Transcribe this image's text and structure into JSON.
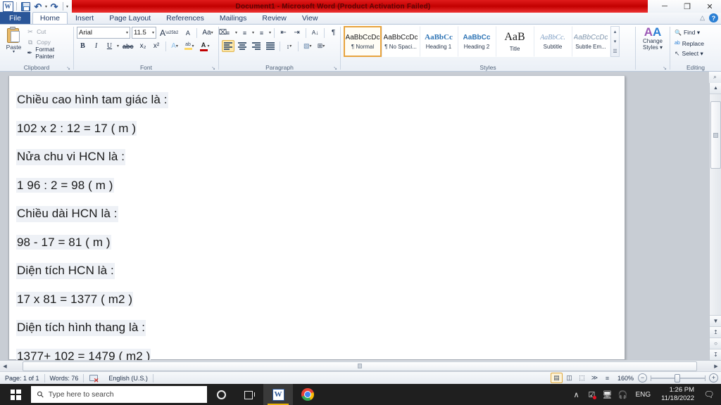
{
  "window": {
    "title": "Document1  -  Microsoft Word (Product Activation Failed)",
    "minimize": "─",
    "restore": "❐",
    "close": "✕",
    "collapse_ribbon": "△",
    "help": "?"
  },
  "quick_access": {
    "app_icon": "W",
    "save": "save-icon",
    "undo": "↶",
    "redo": "↷",
    "caret": "▾"
  },
  "tabs": [
    {
      "label": "File",
      "active": false,
      "file": true
    },
    {
      "label": "Home",
      "active": true,
      "file": false
    },
    {
      "label": "Insert",
      "active": false,
      "file": false
    },
    {
      "label": "Page Layout",
      "active": false,
      "file": false
    },
    {
      "label": "References",
      "active": false,
      "file": false
    },
    {
      "label": "Mailings",
      "active": false,
      "file": false
    },
    {
      "label": "Review",
      "active": false,
      "file": false
    },
    {
      "label": "View",
      "active": false,
      "file": false
    }
  ],
  "ribbon": {
    "clipboard": {
      "label": "Clipboard",
      "paste": "Paste",
      "paste_caret": "▾",
      "items": [
        {
          "label": "Cut",
          "glyph": "✂",
          "enabled": false
        },
        {
          "label": "Copy",
          "glyph": "⧉",
          "enabled": false
        },
        {
          "label": "Format Painter",
          "glyph": "✒",
          "enabled": true
        }
      ]
    },
    "font": {
      "label": "Font",
      "font_name": "Arial",
      "font_size": "11.5",
      "caret": "▾",
      "grow_font": "A",
      "shrink_font": "A",
      "change_case": "Aa",
      "clear_formatting": "⌧",
      "bold": "B",
      "italic": "I",
      "underline": "U",
      "strikethrough": "abc",
      "subscript": "x₂",
      "superscript": "x²",
      "text_effects": "A",
      "highlight": "ab",
      "font_color": "A"
    },
    "paragraph": {
      "label": "Paragraph",
      "bullets": "≡",
      "numbering": "≡",
      "multilevel": "≡",
      "decrease_indent": "⇤",
      "increase_indent": "⇥",
      "sort": "A↓",
      "show_marks": "¶",
      "align_left": "align-left",
      "align_center": "align-center",
      "align_right": "align-right",
      "justify": "justify",
      "line_spacing": "↕",
      "shading": "▧",
      "borders": "⊞"
    },
    "styles": {
      "label": "Styles",
      "items": [
        {
          "preview": "AaBbCcDc",
          "name": "¶ Normal",
          "selected": true,
          "cls": ""
        },
        {
          "preview": "AaBbCcDc",
          "name": "¶ No Spaci...",
          "selected": false,
          "cls": ""
        },
        {
          "preview": "AaBbCс",
          "name": "Heading 1",
          "selected": false,
          "cls": "h1"
        },
        {
          "preview": "AaBbCc",
          "name": "Heading 2",
          "selected": false,
          "cls": "h2"
        },
        {
          "preview": "AaB",
          "name": "Title",
          "selected": false,
          "cls": "title"
        },
        {
          "preview": "AaBbCc.",
          "name": "Subtitle",
          "selected": false,
          "cls": "subtle"
        },
        {
          "preview": "AaBbCcDc",
          "name": "Subtle Em...",
          "selected": false,
          "cls": "subem"
        }
      ],
      "scroll_up": "▴",
      "scroll_down": "▾",
      "more": "☰"
    },
    "change_styles": {
      "label_line1": "Change",
      "label_line2": "Styles ▾",
      "icon": "AA"
    },
    "editing": {
      "label": "Editing",
      "items": [
        {
          "label": "Find ▾",
          "glyph": "🔍"
        },
        {
          "label": "Replace",
          "glyph": "ab"
        },
        {
          "label": "Select ▾",
          "glyph": "↖"
        }
      ]
    },
    "dialog_launcher": "↘"
  },
  "document": {
    "lines": [
      {
        "text": "Chiều cao hình tam giác  là :",
        "spell": "mixed"
      },
      {
        "text": "102 x 2 : 12 = 17 ( m )",
        "spell": "green"
      },
      {
        "text": "Nửa chu vi HCN là :",
        "spell": "mixed"
      },
      {
        "text": "1 96 : 2 = 98 ( m )",
        "spell": "green"
      },
      {
        "text": "Chiều dài HCN là :",
        "spell": "mixed"
      },
      {
        "text": "98 - 17 = 81 ( m )",
        "spell": "green"
      },
      {
        "text": "Diện tích HCN là :",
        "spell": "mixed"
      },
      {
        "text": "17 x 81 = 1377 ( m2 )",
        "spell": "green"
      },
      {
        "text": " Diện tích hình thang là :",
        "spell": "mixed"
      },
      {
        "text": "1377+ 102 = 1479 ( m2 )",
        "spell": "green"
      }
    ]
  },
  "status_bar": {
    "page": "Page: 1 of 1",
    "words": "Words: 76",
    "proofing": "proofing-errors-icon",
    "language": "English (U.S.)",
    "zoom_level": "160%",
    "zoom_out": "−",
    "zoom_in": "+",
    "views": [
      {
        "name": "print-layout",
        "glyph": "▤",
        "selected": true
      },
      {
        "name": "full-screen-reading",
        "glyph": "◫",
        "selected": false
      },
      {
        "name": "web-layout",
        "glyph": "⬚",
        "selected": false
      },
      {
        "name": "outline",
        "glyph": "≫",
        "selected": false
      },
      {
        "name": "draft",
        "glyph": "≡",
        "selected": false
      }
    ]
  },
  "scrollbars": {
    "v_up": "▲",
    "v_down": "▼",
    "v_prev_page": "↥",
    "v_select_object": "○",
    "v_next_page": "↧",
    "ruler_toggle": "⌕",
    "h_left": "◀",
    "h_right": "▶"
  },
  "taskbar": {
    "start": "start-button",
    "search_placeholder": "Type here to search",
    "cortana": "cortana-icon",
    "task_view": "task-view-icon",
    "apps": [
      {
        "name": "word",
        "label": "W",
        "active": true
      },
      {
        "name": "chrome",
        "label": "",
        "active": false
      }
    ],
    "tray": {
      "show_hidden": "∧",
      "security": "🛡",
      "network": "🖧",
      "volume": "🔊",
      "language": "ENG",
      "time": "1:26 PM",
      "date": "11/18/2022",
      "action_center": "🗪"
    }
  },
  "colors": {
    "title_red": "#c20000",
    "accent_blue": "#2a5699",
    "workspace_gray": "#c8cdd4",
    "spell_red": "#e03131",
    "spell_green": "#2f9e44",
    "taskbar": "#1f1f1f"
  }
}
